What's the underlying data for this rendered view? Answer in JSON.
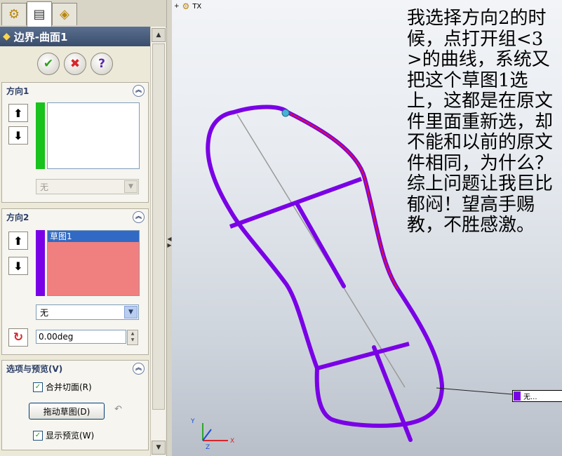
{
  "panel": {
    "title": "边界-曲面1",
    "tabs": [
      "feature-manager-icon",
      "property-manager-icon",
      "configuration-manager-icon"
    ],
    "actions": {
      "ok": "✔",
      "cancel": "✖",
      "help": "?"
    },
    "direction1": {
      "title": "方向1",
      "list_items": [],
      "color": "#19c21c",
      "curve_influence": "无"
    },
    "direction2": {
      "title": "方向2",
      "list_items": [
        "草图1"
      ],
      "color": "#7a00e6",
      "curve_influence": "无",
      "angle": "0.00deg"
    },
    "options": {
      "title": "选项与预览(V)",
      "merge_tangent_faces": {
        "label": "合并切面(R)",
        "checked": true
      },
      "drag_sketch": "拖动草图(D)",
      "show_preview": {
        "label": "显示预览(W)",
        "checked": true
      }
    }
  },
  "viewport": {
    "tree_label": "TX",
    "note": "我选择方向2的时候，点打开组<3>的曲线，系统又把这个草图1选上，这都是在原文件里面重新选，却不能和以前的原文件相同，为什么？综上问题让我巨比郁闷！望高手赐教，不胜感激。",
    "callout": "无...",
    "triad": {
      "x": "X",
      "y": "Y",
      "z": "Z"
    },
    "colors": {
      "curve": "#7a00e6",
      "highlight": "#e0103a",
      "centerline": "#9a9a9a"
    }
  }
}
